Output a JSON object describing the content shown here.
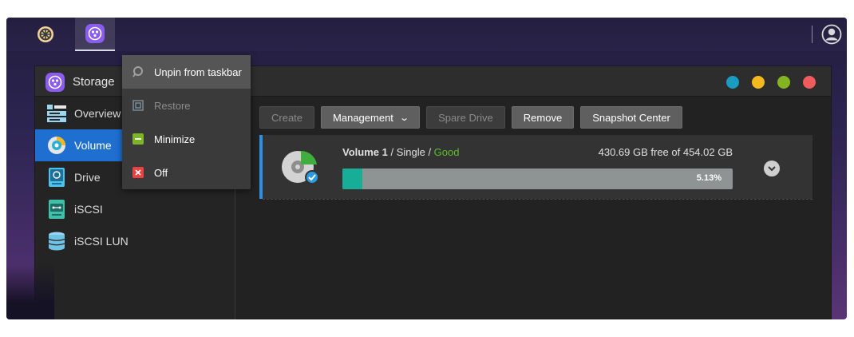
{
  "taskbar": {
    "apps": [
      {
        "icon": "control-panel-icon"
      },
      {
        "icon": "storage-manager-icon",
        "active": true
      }
    ],
    "user_icon": "user-account-icon"
  },
  "window": {
    "title": "Storage",
    "window_buttons": [
      {
        "name": "info",
        "color": "#1a9bc1"
      },
      {
        "name": "minimize",
        "color": "#f5b91f"
      },
      {
        "name": "maximize",
        "color": "#84b521"
      },
      {
        "name": "close",
        "color": "#f05b5b"
      }
    ]
  },
  "sidebar": {
    "items": [
      {
        "label": "Overview",
        "icon": "overview-icon"
      },
      {
        "label": "Volume",
        "icon": "volume-icon",
        "active": true
      },
      {
        "label": "Drive",
        "icon": "drive-icon"
      },
      {
        "label": "iSCSI",
        "icon": "iscsi-icon"
      },
      {
        "label": "iSCSI LUN",
        "icon": "iscsi-lun-icon"
      }
    ]
  },
  "toolbar": {
    "create_label": "Create",
    "management_label": "Management",
    "spare_drive_label": "Spare Drive",
    "remove_label": "Remove",
    "snapshot_center_label": "Snapshot Center"
  },
  "volume": {
    "name": "Volume 1",
    "separator": " / ",
    "raid_type": "Single",
    "status": "Good",
    "status_color": "#5cbf2a",
    "capacity_text": "430.69 GB free of 454.02 GB",
    "usage_percent": 5.13,
    "usage_label": "5.13%"
  },
  "context_menu": {
    "items": [
      {
        "label": "Unpin from taskbar",
        "icon": "unpin-icon",
        "hover": true
      },
      {
        "label": "Restore",
        "icon": "restore-icon",
        "disabled": true
      },
      {
        "label": "Minimize",
        "icon": "minimize-icon"
      },
      {
        "label": "Off",
        "icon": "close-icon"
      }
    ]
  }
}
